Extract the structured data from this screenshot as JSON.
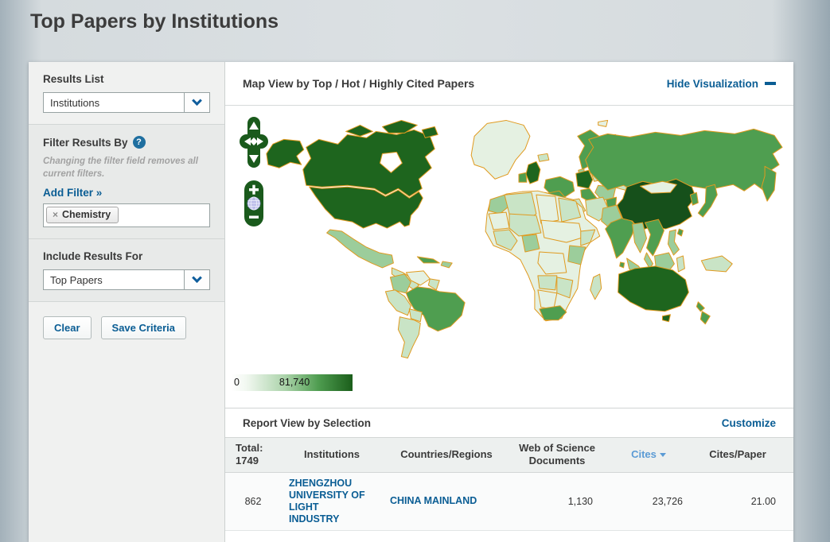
{
  "page": {
    "title": "Top Papers by Institutions"
  },
  "sidebar": {
    "results_list": {
      "label": "Results List",
      "selected": "Institutions"
    },
    "filter": {
      "label": "Filter Results By",
      "help_icon": "?",
      "note": "Changing the filter field removes all current filters.",
      "add_filter_label": "Add Filter »",
      "chips": [
        {
          "remove_icon": "×",
          "label": "Chemistry"
        }
      ]
    },
    "include": {
      "label": "Include Results For",
      "selected": "Top Papers"
    },
    "actions": {
      "clear_label": "Clear",
      "save_label": "Save Criteria"
    }
  },
  "visualization": {
    "header": "Map View by Top / Hot / Highly Cited Papers",
    "hide_label": "Hide Visualization",
    "legend": {
      "min": "0",
      "max": "81,740",
      "min_color": "#ffffff",
      "max_color": "#1b5e1b"
    },
    "map_palette": {
      "highest": "#16501b",
      "high": "#1e651e",
      "medium": "#4f9e50",
      "low": "#9ccd9b",
      "lower": "#c9e4c6",
      "lowest": "#e5f1e2",
      "country_border": "#e09a1f",
      "ocean": "#ffffff"
    }
  },
  "report": {
    "header": "Report View by Selection",
    "customize_label": "Customize",
    "table": {
      "total_label": "Total:",
      "total_value": "1749",
      "columns": [
        "Institutions",
        "Countries/Regions",
        "Web of Science Documents",
        "Cites",
        "Cites/Paper"
      ],
      "sorted_column": "Cites",
      "rows": [
        {
          "rank": "862",
          "institution": "ZHENGZHOU UNIVERSITY OF LIGHT INDUSTRY",
          "country": "CHINA MAINLAND",
          "documents": "1,130",
          "cites": "23,726",
          "cites_per_paper": "21.00"
        }
      ]
    }
  },
  "colors": {
    "accent_blue": "#0a5d94",
    "sorted_column_blue": "#5b9bd5"
  }
}
